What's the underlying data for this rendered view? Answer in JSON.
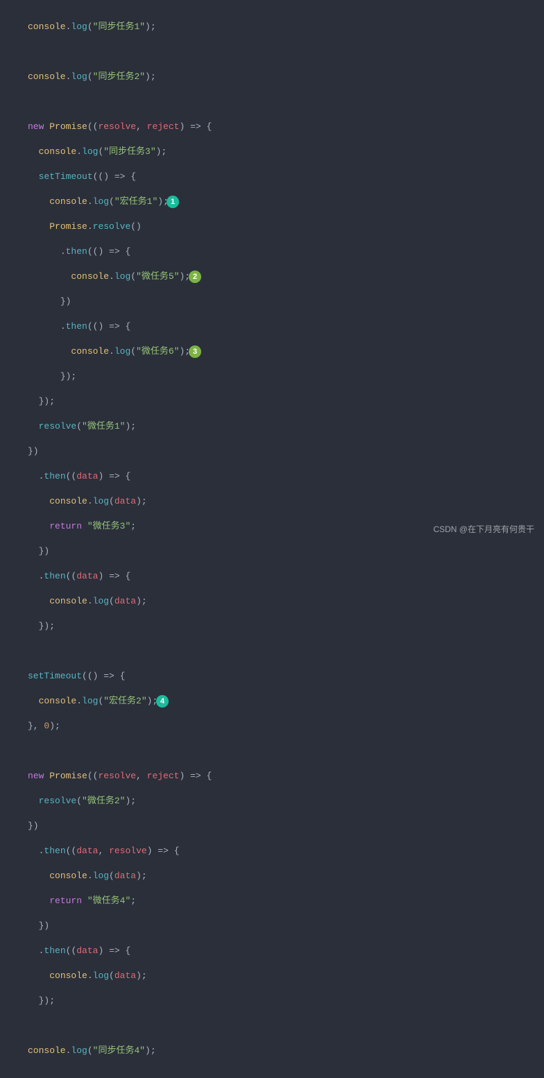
{
  "code": {
    "sync1": "\"同步任务1\"",
    "sync2": "\"同步任务2\"",
    "sync3": "\"同步任务3\"",
    "macro1": "\"宏任务1\"",
    "macro2": "\"宏任务2\"",
    "micro1": "\"微任务1\"",
    "micro2": "\"微任务2\"",
    "micro3": "\"微任务3\"",
    "micro4": "\"微任务4\"",
    "micro5": "\"微任务5\"",
    "micro6": "\"微任务6\"",
    "sync4": "\"同步任务4\"",
    "kw_new": "new",
    "kw_return": "return",
    "cls_promise": "Promise",
    "m_log": "log",
    "m_then": "then",
    "m_resolve": "resolve",
    "m_setTimeout": "setTimeout",
    "p_resolve": "resolve",
    "p_reject": "reject",
    "p_data": "data",
    "obj_console": "console",
    "zero": "0"
  },
  "badges": {
    "b1": "1",
    "b2": "2",
    "b3": "3",
    "b4": "4"
  },
  "watermark": "CSDN @在下月亮有何贵干"
}
